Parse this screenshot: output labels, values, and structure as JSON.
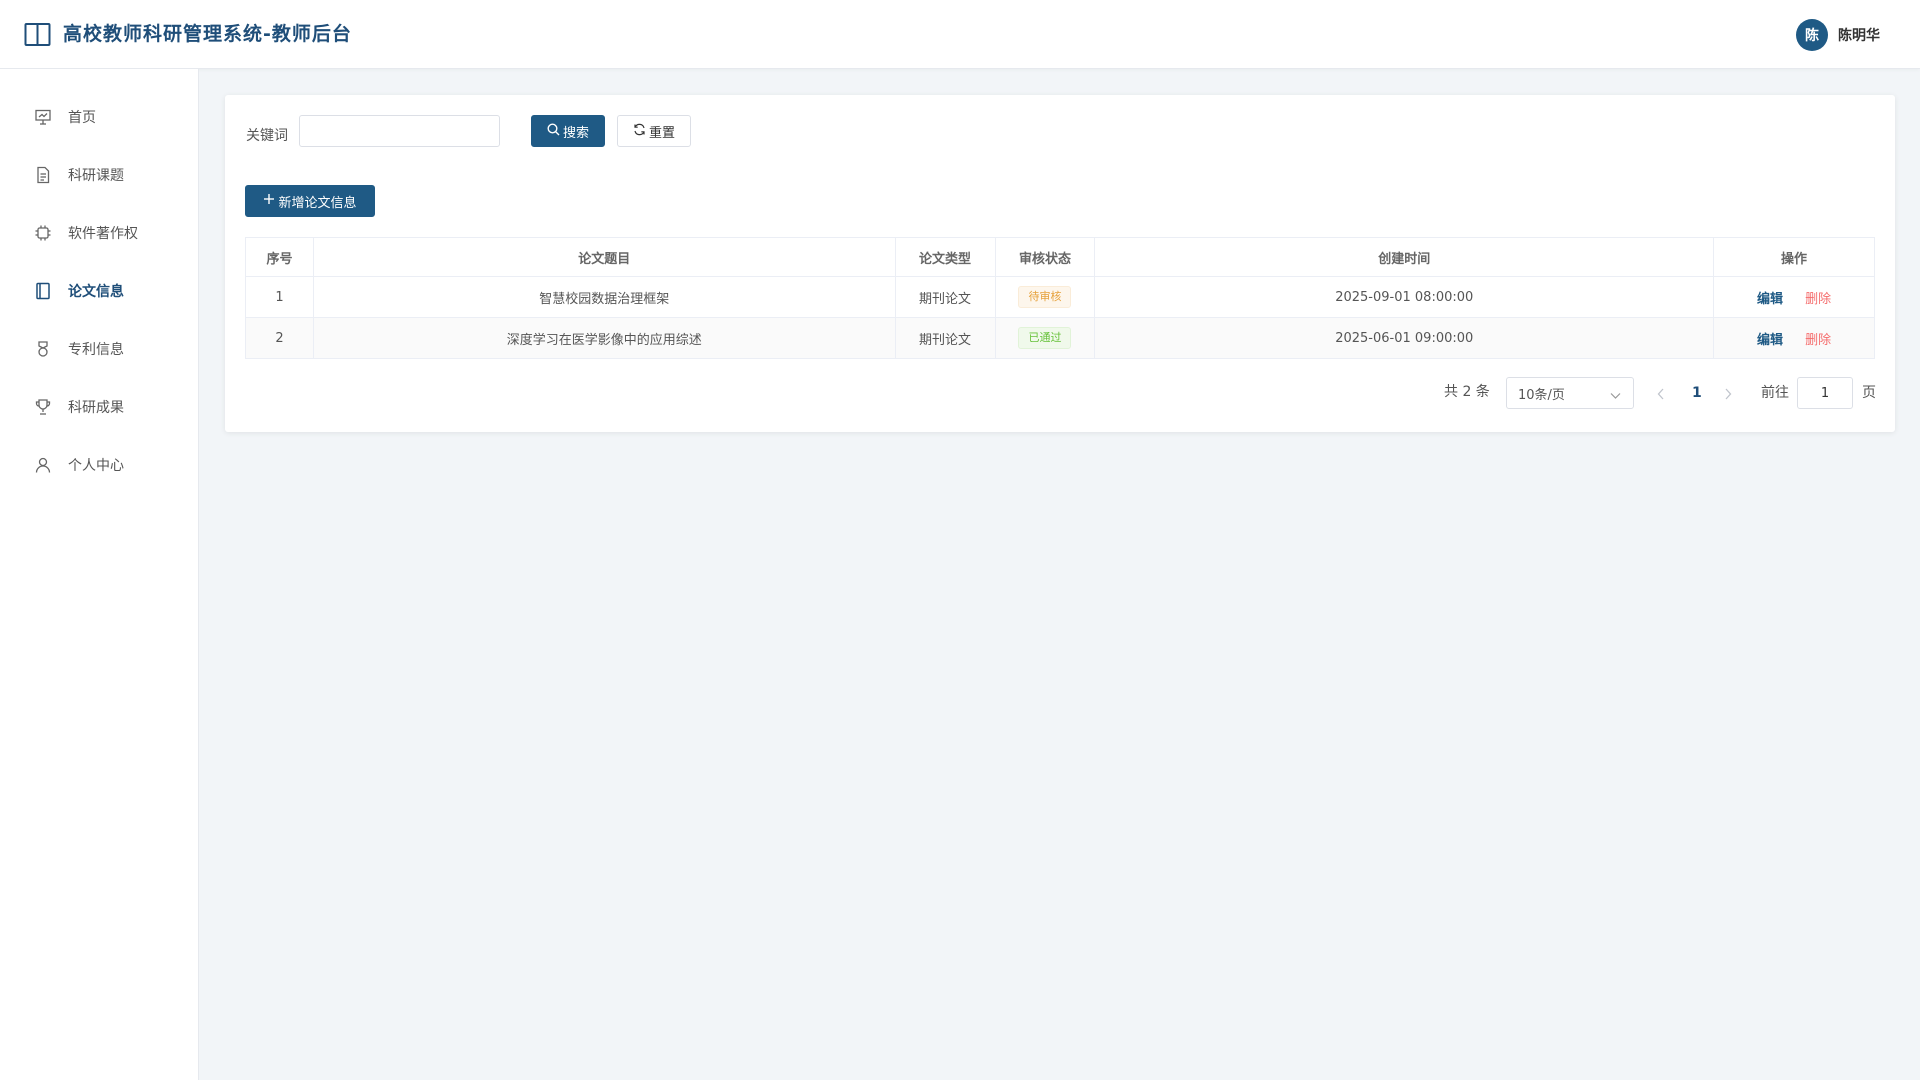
{
  "header": {
    "title": "高校教师科研管理系统-教师后台",
    "avatar_text": "陈",
    "user_name": "陈明华"
  },
  "sidebar": {
    "items": [
      {
        "label": "首页",
        "icon": "presentation-icon"
      },
      {
        "label": "科研课题",
        "icon": "document-icon"
      },
      {
        "label": "软件著作权",
        "icon": "chip-icon"
      },
      {
        "label": "论文信息",
        "icon": "notebook-icon",
        "active": true
      },
      {
        "label": "专利信息",
        "icon": "medal-icon"
      },
      {
        "label": "科研成果",
        "icon": "trophy-icon"
      },
      {
        "label": "个人中心",
        "icon": "user-icon"
      }
    ]
  },
  "search": {
    "keyword_label": "关键词",
    "keyword_value": "",
    "search_label": "搜索",
    "reset_label": "重置"
  },
  "toolbar": {
    "add_label": "新增论文信息"
  },
  "table": {
    "columns": [
      "序号",
      "论文题目",
      "论文类型",
      "审核状态",
      "创建时间",
      "操作"
    ],
    "rows": [
      {
        "index": "1",
        "title": "智慧校园数据治理框架",
        "type": "期刊论文",
        "status": "待审核",
        "created": "2025-09-01 08:00:00",
        "edit": "编辑",
        "delete": "删除"
      },
      {
        "index": "2",
        "title": "深度学习在医学影像中的应用综述",
        "type": "期刊论文",
        "status": "已通过",
        "created": "2025-06-01 09:00:00",
        "edit": "编辑",
        "delete": "删除"
      }
    ]
  },
  "pagination": {
    "total_text": "共 2 条",
    "page_size": "10条/页",
    "current_page": "1",
    "goto_label": "前往",
    "goto_value": "1",
    "page_suffix": "页"
  },
  "colors": {
    "primary": "#1f5a85",
    "title": "#1f4e79",
    "danger": "#f56c6c",
    "warning": "#e6a23c",
    "success": "#67c23a",
    "background": "#f2f5f8"
  }
}
